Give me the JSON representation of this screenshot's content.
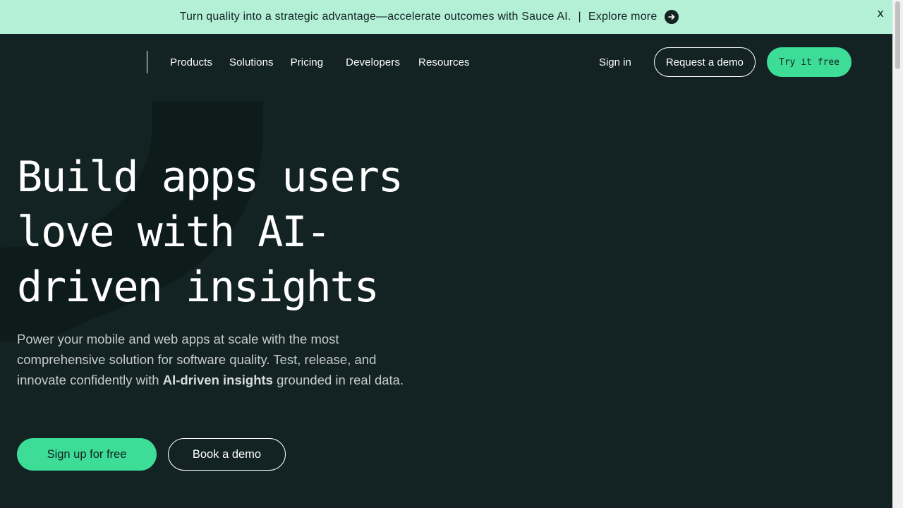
{
  "banner": {
    "message": "Turn quality into a strategic advantage—accelerate outcomes with Sauce AI.",
    "separator": "|",
    "link_label": "Explore more",
    "close_label": "x"
  },
  "nav": {
    "links": [
      "Products",
      "Solutions",
      "Pricing",
      "Developers",
      "Resources"
    ],
    "sign_in": "Sign in",
    "request_demo": "Request a demo",
    "try_free": "Try it free"
  },
  "hero": {
    "title_lines": [
      "Build apps users",
      "love with AI-",
      "driven insights"
    ],
    "desc_before": "Power your mobile and web apps at scale with the most comprehensive solution for software quality. Test, release, and innovate confidently with ",
    "desc_bold": "AI-driven insights",
    "desc_after": " grounded in real data.",
    "cta_primary": "Sign up for free",
    "cta_secondary": "Book a demo"
  },
  "colors": {
    "background": "#132222",
    "banner": "#b3f0d6",
    "accent": "#3ddc97"
  },
  "icons": {
    "banner_link": "arrow-right-circle-icon",
    "banner_close": "close-icon"
  }
}
